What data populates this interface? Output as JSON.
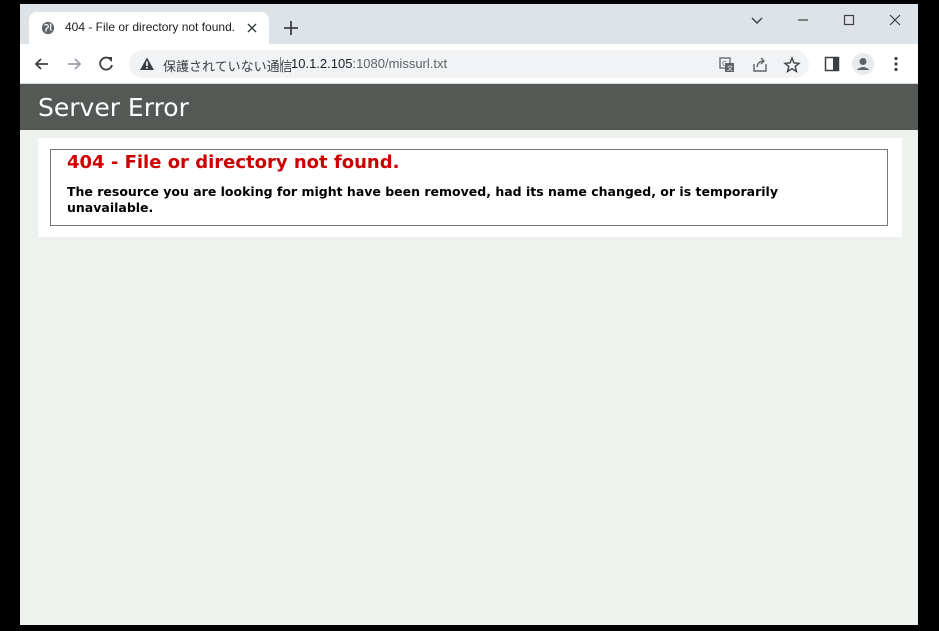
{
  "browser": {
    "tab_title": "404 - File or directory not found.",
    "address": {
      "security_label": "保護されていない通信",
      "host": "10.1.2.105",
      "path": ":1080/missurl.txt"
    },
    "icons": [
      "globe-icon",
      "close-icon",
      "plus-icon",
      "chevron-down-icon",
      "minimize-icon",
      "maximize-icon",
      "window-close-icon",
      "back-icon",
      "forward-icon",
      "reload-icon",
      "warning-icon",
      "translate-icon",
      "share-icon",
      "star-icon",
      "side-panel-icon",
      "profile-icon",
      "more-icon"
    ]
  },
  "page": {
    "header_title": "Server Error",
    "error_heading": "404 - File or directory not found.",
    "error_message": "The resource you are looking for might have been removed, had its name changed, or is temporarily unavailable."
  },
  "colors": {
    "header_bg": "#555956",
    "error_red": "#cc0000",
    "page_bg": "#eef2ee"
  }
}
